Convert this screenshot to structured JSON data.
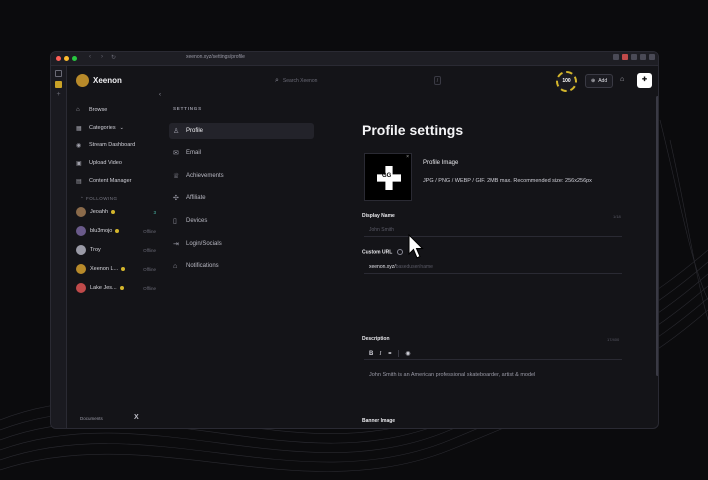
{
  "browser": {
    "url": "xeenon.xyz/settings/profile"
  },
  "topbar": {
    "brand": "Xeenon",
    "search_placeholder": "Search Xeenon",
    "search_shortcut": "/",
    "coin_balance": "100",
    "add_label": "Add"
  },
  "sidebar": {
    "items": [
      {
        "label": "Browse"
      },
      {
        "label": "Categories"
      },
      {
        "label": "Stream Dashboard"
      },
      {
        "label": "Upload Video"
      },
      {
        "label": "Content Manager"
      }
    ],
    "following_title": "FOLLOWING",
    "following": [
      {
        "name": "Jeoahh",
        "status": "3",
        "live": true,
        "color": "#8a6a4a"
      },
      {
        "name": "blu3mojo",
        "status": "Offline",
        "live": false,
        "color": "#6a5a8a"
      },
      {
        "name": "Troy",
        "status": "Offline",
        "live": false,
        "color": "#9a9aa6"
      },
      {
        "name": "Xeenon L...",
        "status": "Offline",
        "live": false,
        "color": "#b88a2a"
      },
      {
        "name": "Lake Jes...",
        "status": "Offline",
        "live": false,
        "color": "#c04a4a"
      }
    ],
    "documents_label": "Documents",
    "x_label": "X"
  },
  "settings_nav": {
    "title": "SETTINGS",
    "items": [
      {
        "label": "Profile",
        "active": true
      },
      {
        "label": "Email",
        "active": false
      },
      {
        "label": "Achievements",
        "active": false
      },
      {
        "label": "Affiliate",
        "active": false
      },
      {
        "label": "Devices",
        "active": false
      },
      {
        "label": "Login/Socials",
        "active": false
      },
      {
        "label": "Notifications",
        "active": false
      }
    ]
  },
  "profile": {
    "title": "Profile settings",
    "image_label": "Profile Image",
    "image_help": "JPG / PNG / WEBP / GIF. 2MB max. Recommended size: 256x256px",
    "image_text": "GG",
    "display_name_label": "Display Name",
    "display_name_count": "1/18",
    "display_name_placeholder": "John Smith",
    "custom_url_label": "Custom URL",
    "custom_url_prefix": "xeenon.xyz/",
    "custom_url_placeholder": "baseduser/name",
    "description_label": "Description",
    "description_count": "17/400",
    "description_text": "John Smith is an American professional skateboarder, artist & model",
    "banner_label": "Banner Image"
  },
  "colors": {
    "accent": "#d4b62c",
    "background": "#141418",
    "live": "#4fc3b0"
  }
}
